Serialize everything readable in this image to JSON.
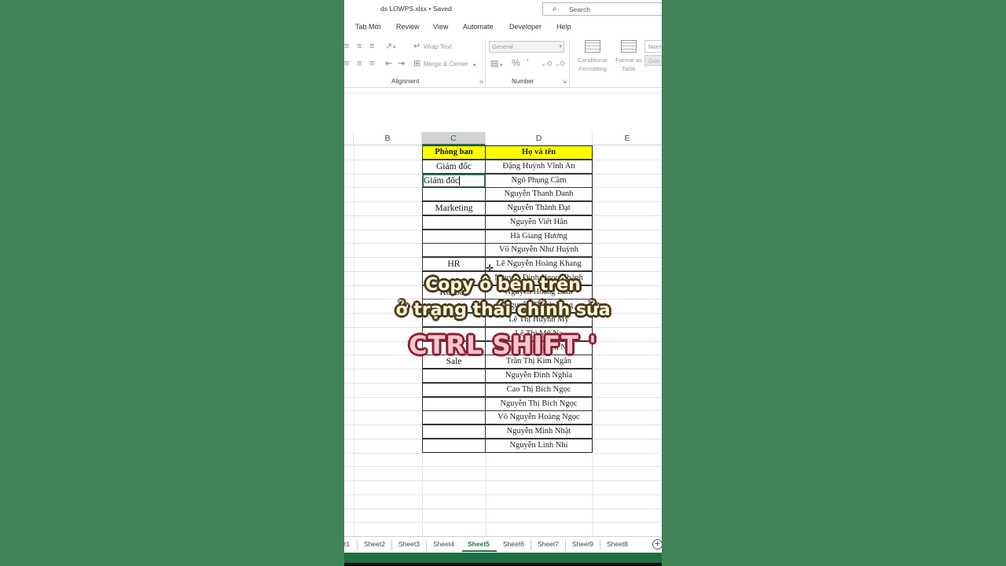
{
  "titlebar": {
    "file_title": "ds LOWPS.xlsx • Saved",
    "search_label": "Search"
  },
  "menu": [
    "Tab Mới",
    "Review",
    "View",
    "Automate",
    "Developer",
    "Help"
  ],
  "ribbon": {
    "wrap_text": "Wrap Text",
    "merge_center": "Merge & Center",
    "alignment_label": "Alignment",
    "number_format": "General",
    "number_label": "Number",
    "conditional_formatting": [
      "Conditional",
      "Formatting"
    ],
    "format_as_table": [
      "Format as",
      "Table"
    ],
    "style_normal": "Norm",
    "style_good": "Goo"
  },
  "columns": {
    "b": "B",
    "c": "C",
    "d": "D",
    "e": "E"
  },
  "table": {
    "header_c": "Phòng ban",
    "header_d": "Họ và tên",
    "col_c": [
      "Giám đốc",
      "Giám đốc",
      "",
      "Marketing",
      "",
      "",
      "",
      "HR",
      "",
      "Kế toán",
      "",
      "",
      "",
      "",
      "Sale",
      "",
      "",
      "",
      "",
      "",
      ""
    ],
    "col_d": [
      "Đặng Huỳnh Vĩnh An",
      "Ngô Phụng Cầm",
      "Nguyễn Thanh Danh",
      "Nguyễn Thành Đạt",
      "Nguyễn Viết Hân",
      "Hà Giang Hương",
      "Võ Nguyễn Như Huỳnh",
      "Lê Nguyễn Hoàng Khang",
      "Nguyễn Đình Ngọc Khánh",
      "Nguyễn Hoàng Lâm",
      "Nguyễn Thanh Long",
      "Lê Thị Huỳnh My",
      "Lê Thị Mỹ Na",
      "Trịnh Thị Huyền Nga",
      "Trần Thị Kim Ngân",
      "Nguyễn Đình Nghĩa",
      "Cao Thị Bích Ngọc",
      "Nguyễn Thị Bích Ngọc",
      "Võ Nguyễn Hoàng Ngọc",
      "Nguyễn Minh Nhật",
      "Nguyễn Linh Nhi"
    ],
    "editing_row": 1
  },
  "captions": {
    "line1": "Copy ô bên trên",
    "line2": "ở trạng thái chỉnh sửa",
    "shortcut": "CTRL SHIFT '"
  },
  "sheets": {
    "partial_first": "t1",
    "tabs": [
      "Sheet2",
      "Sheet3",
      "Sheet4",
      "Sheet5",
      "Sheet6",
      "Sheet7",
      "Sheet9",
      "Sheet8"
    ],
    "active": "Sheet5"
  },
  "colors": {
    "background": "#418356",
    "excel_green": "#217346",
    "header_fill": "#ffff00",
    "caption_shortcut": "#f4c7cc"
  }
}
